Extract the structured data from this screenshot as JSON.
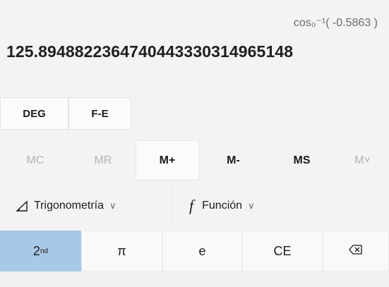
{
  "display": {
    "expression": "cos₀⁻¹( -0.5863 )",
    "result": "125.89488223647404433303149651​48"
  },
  "mode": {
    "deg_label": "DEG",
    "fe_label": "F-E"
  },
  "memory": {
    "mc": "MC",
    "mr": "MR",
    "mplus": "M+",
    "mminus": "M-",
    "ms": "MS",
    "mlist": "M˅"
  },
  "dropdowns": {
    "trig": "Trigonometría",
    "func": "Función"
  },
  "keys": {
    "second_base": "2",
    "second_sup": "nd",
    "pi": "π",
    "e": "e",
    "ce": "CE",
    "backspace": "⌫"
  },
  "colors": {
    "background": "#f3f3f3",
    "active_key": "#a8c8e7",
    "disabled_text": "#b3b3b3"
  }
}
